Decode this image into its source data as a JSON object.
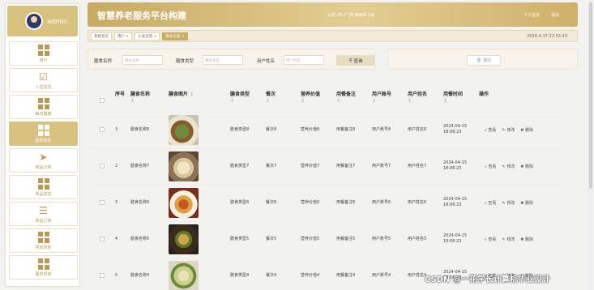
{
  "user": {
    "name": "admin"
  },
  "menu": [
    {
      "label": "用户",
      "icon": "grid-icon"
    },
    {
      "label": "入住信息",
      "icon": "checkbox-icon"
    },
    {
      "label": "每日健康",
      "icon": "grid-icon"
    },
    {
      "label": "膳食信息",
      "icon": "grid-icon",
      "active": true
    },
    {
      "label": "商品分类",
      "icon": "send-icon"
    },
    {
      "label": "商品信息",
      "icon": "grid-icon"
    },
    {
      "label": "商品订单",
      "icon": "list-icon"
    },
    {
      "label": "项目类别",
      "icon": "grid-icon"
    },
    {
      "label": "服务项目",
      "icon": "grid-icon"
    }
  ],
  "header": {
    "title": "智慧养老服务平台构建",
    "weather": "云阵 28.2° 阴 西南风 1级",
    "profile": "个人信息",
    "logout": "退出"
  },
  "tabs": [
    {
      "label": "系统首页"
    },
    {
      "label": "用户 ×"
    },
    {
      "label": "入住信息 ×"
    },
    {
      "label": "膳食信息 ×",
      "active": true
    }
  ],
  "clock": "2024-4-17 22:52:43",
  "search": {
    "name_label": "膳食名称",
    "name_placeholder": "膳食名称",
    "type_label": "膳食类型",
    "type_placeholder": "膳食类型",
    "user_label": "用户姓名",
    "user_placeholder": "用户姓名",
    "button": "查询"
  },
  "actions": {
    "delete": "删除"
  },
  "table": {
    "headers": [
      "序号",
      "膳食名称",
      "膳食图片",
      "膳食类型",
      "餐次",
      "营养价值",
      "用餐备注",
      "用户账号",
      "用户姓名",
      "用餐时间",
      "操作"
    ],
    "rows": [
      {
        "no": "3",
        "name": "膳食名称8",
        "type": "膳食类型8",
        "meal": "餐次8",
        "nutrition": "营养价值8",
        "remark": "用餐备注8",
        "account": "用户账号8",
        "username": "用户姓名8",
        "time": "2024-04-15 18:06:23"
      },
      {
        "no": "2",
        "name": "膳食名称7",
        "type": "膳食类型7",
        "meal": "餐次7",
        "nutrition": "营养价值7",
        "remark": "用餐备注7",
        "account": "用户账号7",
        "username": "用户姓名7",
        "time": "2024-04-15 18:06:23"
      },
      {
        "no": "3",
        "name": "膳食名称6",
        "type": "膳食类型6",
        "meal": "餐次6",
        "nutrition": "营养价值6",
        "remark": "用餐备注6",
        "account": "用户账号6",
        "username": "用户姓名6",
        "time": "2024-04-15 18:06:23"
      },
      {
        "no": "4",
        "name": "膳食名称5",
        "type": "膳食类型5",
        "meal": "餐次5",
        "nutrition": "营养价值5",
        "remark": "用餐备注5",
        "account": "用户账号5",
        "username": "用户姓名5",
        "time": "2024-04-15 18:06:23"
      },
      {
        "no": "5",
        "name": "膳食名称4",
        "type": "膳食类型4",
        "meal": "餐次4",
        "nutrition": "营养价值4",
        "remark": "用餐备注4",
        "account": "用户账号4",
        "username": "用户姓名4",
        "time": "2024-04-15 18:06:23"
      }
    ],
    "ops": {
      "view": "查看",
      "edit": "修改",
      "del": "删除"
    }
  },
  "watermark": "CSDN @一花学长计算机毕业设计",
  "colors": {
    "accent": "#c9ac65",
    "active_menu": "#d9c27f"
  }
}
